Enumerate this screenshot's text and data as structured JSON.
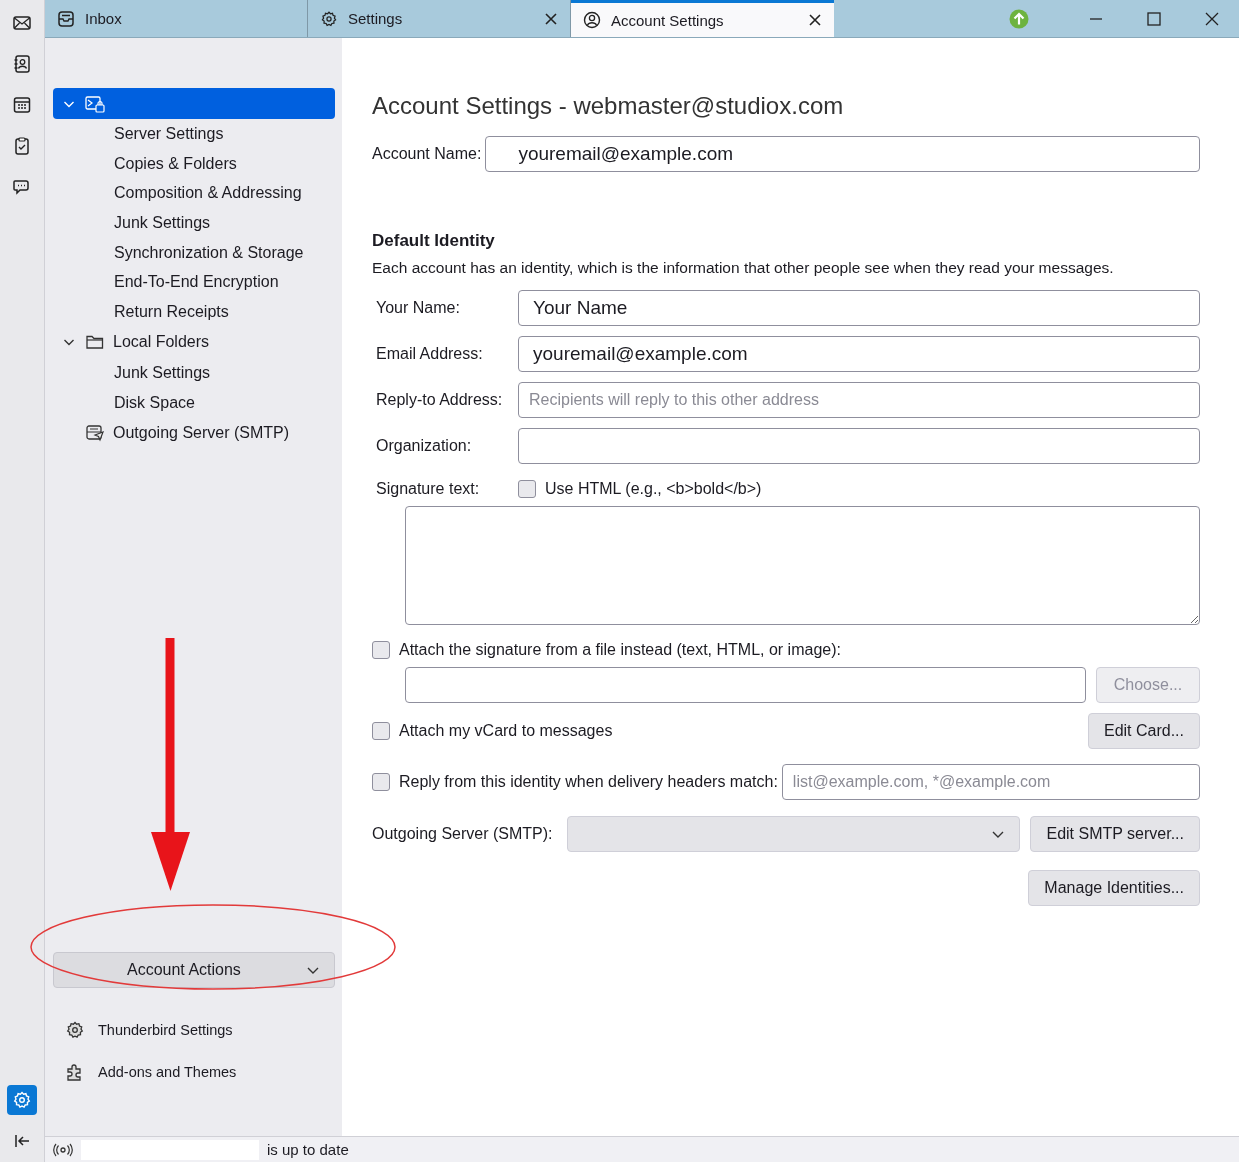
{
  "rail": [
    {
      "kind": "mail",
      "selected": false
    },
    {
      "kind": "contacts",
      "selected": false
    },
    {
      "kind": "calendar",
      "selected": false
    },
    {
      "kind": "tasks",
      "selected": false
    },
    {
      "kind": "chat",
      "selected": false
    }
  ],
  "rail_bottom": [
    {
      "kind": "settings",
      "selected": true
    },
    {
      "kind": "collapse",
      "selected": false
    }
  ],
  "tabs": [
    {
      "kind": "inbox",
      "label": "Inbox",
      "selected": false,
      "closable": false
    },
    {
      "kind": "settings",
      "label": "Settings",
      "selected": false,
      "closable": true
    },
    {
      "kind": "account",
      "label": "Account Settings",
      "selected": true,
      "closable": true
    }
  ],
  "tree": [
    {
      "kind": "account",
      "expanded": true,
      "selected": true,
      "children": [
        {
          "label": "Server Settings"
        },
        {
          "label": "Copies & Folders"
        },
        {
          "label": "Composition & Addressing"
        },
        {
          "label": "Junk Settings"
        },
        {
          "label": "Synchronization & Storage"
        },
        {
          "label": "End-To-End Encryption"
        },
        {
          "label": "Return Receipts"
        }
      ]
    },
    {
      "kind": "folder",
      "label": "Local Folders",
      "expanded": true,
      "selected": false,
      "children": [
        {
          "label": "Junk Settings"
        },
        {
          "label": "Disk Space"
        }
      ]
    },
    {
      "kind": "smtp",
      "label": "Outgoing Server (SMTP)",
      "selected": false
    }
  ],
  "account_actions": {
    "label": "Account Actions"
  },
  "sidebar_links": [
    {
      "kind": "gear",
      "label": "Thunderbird Settings"
    },
    {
      "kind": "puzzle",
      "label": "Add-ons and Themes"
    }
  ],
  "heading": "Account Settings - webmaster@studiox.com",
  "account_name": {
    "label": "Account Name:",
    "value": "youremail@example.com"
  },
  "section_title": "Default Identity",
  "description": "Each account has an identity, which is the information that other people see when they read your messages.",
  "fields": [
    {
      "label": "Your Name:",
      "value": "Your Name"
    },
    {
      "label": "Email Address:",
      "value": "youremail@example.com"
    },
    {
      "label": "Reply-to Address:",
      "placeholder": "Recipients will reply to this other address"
    },
    {
      "label": "Organization:"
    }
  ],
  "signature": {
    "label": "Signature text:",
    "use_html": {
      "label": "Use HTML (e.g., <b>bold</b>)",
      "checked": false
    }
  },
  "attach_file": {
    "label": "Attach the signature from a file instead (text, HTML, or image):",
    "checked": false
  },
  "choose_button": {
    "label": "Choose...",
    "disabled": true
  },
  "vcard": {
    "label": "Attach my vCard to messages",
    "checked": false
  },
  "edit_card_button": {
    "label": "Edit Card..."
  },
  "reply_from": {
    "label": "Reply from this identity when delivery headers match:",
    "checked": false,
    "placeholder": "list@example.com, *@example.com"
  },
  "outgoing": {
    "label": "Outgoing Server (SMTP):",
    "button": "Edit SMTP server..."
  },
  "manage_button": {
    "label": "Manage Identities..."
  },
  "status_bar": {
    "text": "is up to date"
  }
}
